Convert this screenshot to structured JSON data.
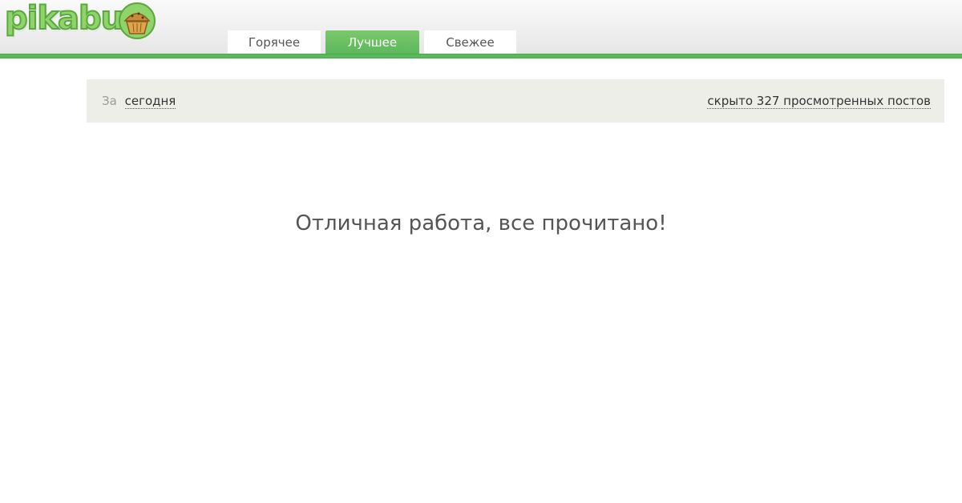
{
  "header": {
    "logo_text": "pikabu",
    "logo_icon": "muffin-icon",
    "accent_color": "#5cb85c",
    "tabs": [
      {
        "label": "Горячее",
        "active": false
      },
      {
        "label": "Лучшее",
        "active": true
      },
      {
        "label": "Свежее",
        "active": false
      }
    ]
  },
  "filter": {
    "prefix": "За",
    "period": "сегодня",
    "hidden_posts": "скрыто 327 просмотренных постов"
  },
  "main": {
    "empty_message": "Отличная работа, все прочитано!"
  }
}
